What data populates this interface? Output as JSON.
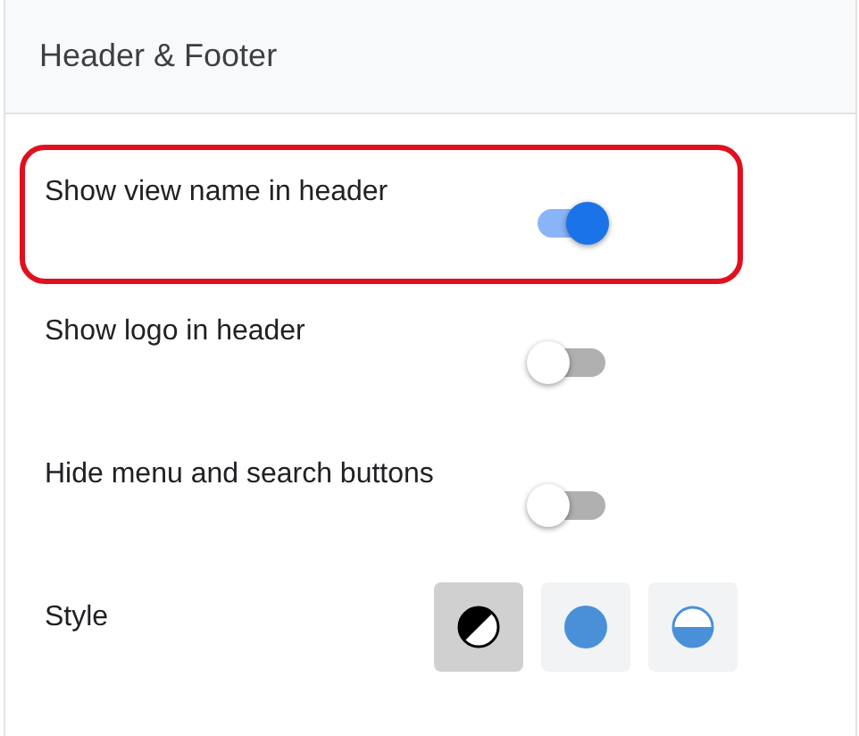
{
  "panel": {
    "title": "Header & Footer"
  },
  "settings": [
    {
      "kind": "toggle",
      "label": "Show view name in header",
      "on": true,
      "highlighted": true
    },
    {
      "kind": "toggle",
      "label": "Show logo in header",
      "on": false,
      "highlighted": false
    },
    {
      "kind": "toggle",
      "label": "Hide menu and search buttons",
      "on": false,
      "highlighted": false
    },
    {
      "kind": "style",
      "label": "Style",
      "highlighted": false,
      "options": [
        {
          "kind": "contrast",
          "selected": true
        },
        {
          "kind": "solid",
          "selected": false
        },
        {
          "kind": "half",
          "selected": false
        }
      ]
    }
  ]
}
